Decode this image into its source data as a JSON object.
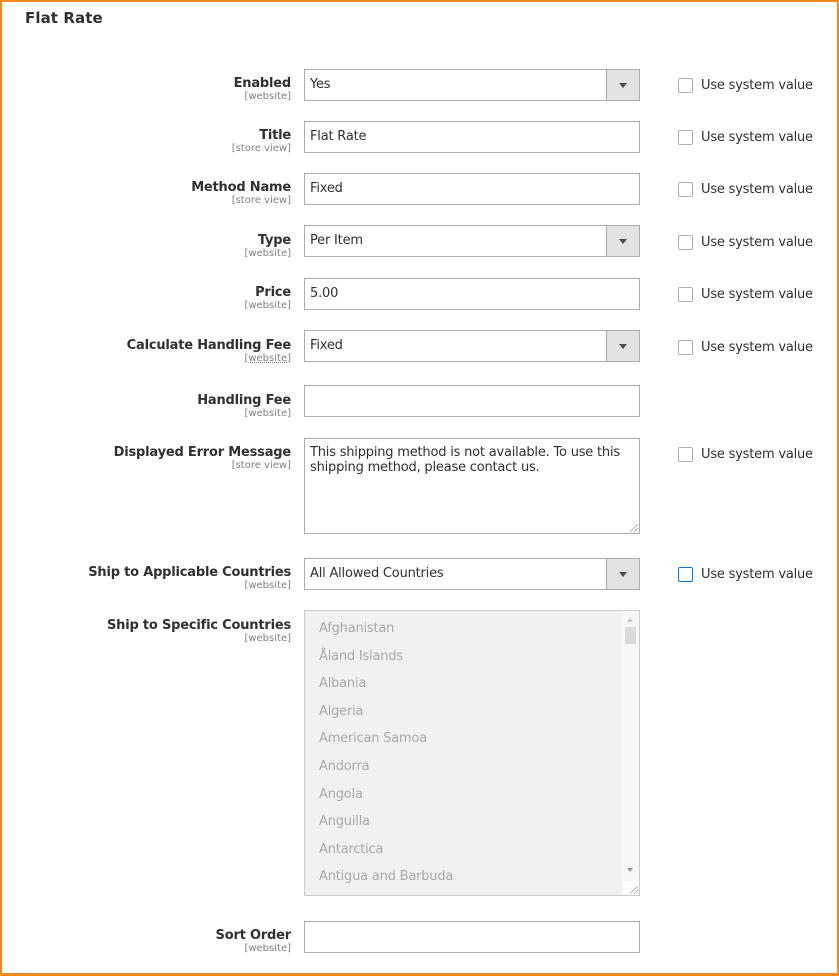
{
  "section": {
    "title": "Flat Rate"
  },
  "use_system_value_label": "Use system value",
  "fields": {
    "enabled": {
      "label": "Enabled",
      "scope": "[website]",
      "value": "Yes"
    },
    "title": {
      "label": "Title",
      "scope": "[store view]",
      "value": "Flat Rate"
    },
    "method_name": {
      "label": "Method Name",
      "scope": "[store view]",
      "value": "Fixed"
    },
    "type": {
      "label": "Type",
      "scope": "[website]",
      "value": "Per Item"
    },
    "price": {
      "label": "Price",
      "scope": "[website]",
      "value": "5.00"
    },
    "calculate_handling_fee": {
      "label": "Calculate Handling Fee",
      "scope": "[website]",
      "value": "Fixed"
    },
    "handling_fee": {
      "label": "Handling Fee",
      "scope": "[website]",
      "value": ""
    },
    "error_message": {
      "label": "Displayed Error Message",
      "scope": "[store view]",
      "value": "This shipping method is not available. To use this shipping method, please contact us."
    },
    "ship_applicable": {
      "label": "Ship to Applicable Countries",
      "scope": "[website]",
      "value": "All Allowed Countries"
    },
    "ship_specific": {
      "label": "Ship to Specific Countries",
      "scope": "[website]",
      "options": [
        "Afghanistan",
        "Åland Islands",
        "Albania",
        "Algeria",
        "American Samoa",
        "Andorra",
        "Angola",
        "Anguilla",
        "Antarctica",
        "Antigua and Barbuda"
      ]
    },
    "sort_order": {
      "label": "Sort Order",
      "scope": "[website]",
      "value": ""
    }
  },
  "colors": {
    "frame_border": "#f28a1c",
    "focus_checkbox": "#007bdb"
  }
}
